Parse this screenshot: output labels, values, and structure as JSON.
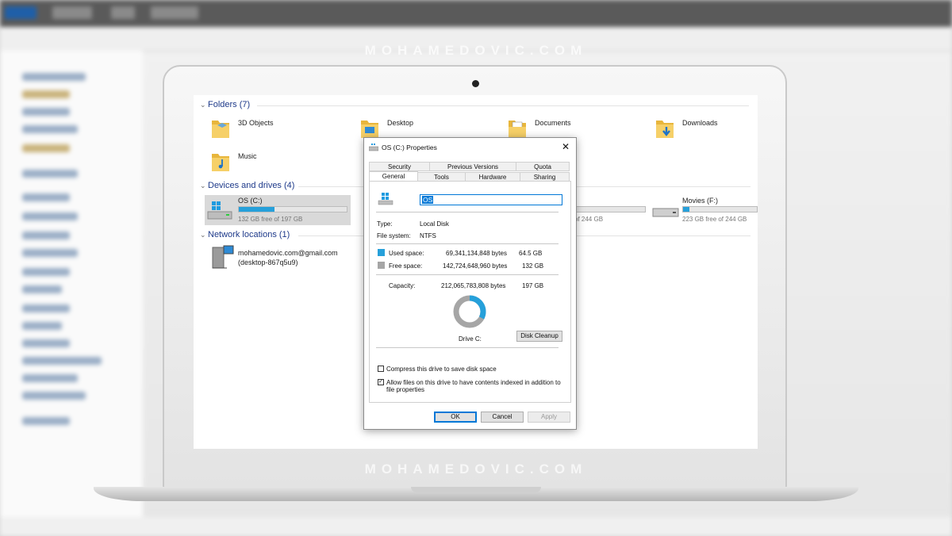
{
  "brand": {
    "top": "MOHAMEDOVIC.COM",
    "bottom": "MOHAMEDOVIC.COM"
  },
  "explorer": {
    "folders_header": "Folders (7)",
    "folders": [
      {
        "name": "3D Objects"
      },
      {
        "name": "Desktop"
      },
      {
        "name": "Documents"
      },
      {
        "name": "Downloads"
      },
      {
        "name": "Music"
      }
    ],
    "devices_header": "Devices and drives (4)",
    "drives": [
      {
        "name": "OS (C:)",
        "free": "132 GB free of 197 GB",
        "used_fraction": 0.33
      },
      {
        "name": "",
        "free": "free of 244 GB",
        "used_fraction": 0.1
      },
      {
        "name": "Movies (F:)",
        "free": "223 GB free of 244 GB",
        "used_fraction": 0.09
      }
    ],
    "network_header": "Network locations (1)",
    "network": {
      "line1": "mohamedovic.com@gmail.com",
      "line2": "(desktop-867q5u9)"
    }
  },
  "dialog": {
    "title": "OS (C:) Properties",
    "tabs_top": [
      "Security",
      "Previous Versions",
      "Quota"
    ],
    "tabs_bottom": [
      "General",
      "Tools",
      "Hardware",
      "Sharing"
    ],
    "name_value": "OS",
    "type_label": "Type:",
    "type_value": "Local Disk",
    "fs_label": "File system:",
    "fs_value": "NTFS",
    "used_label": "Used space:",
    "used_bytes": "69,341,134,848 bytes",
    "used_gb": "64.5 GB",
    "free_label": "Free space:",
    "free_bytes": "142,724,648,960 bytes",
    "free_gb": "132 GB",
    "capacity_label": "Capacity:",
    "capacity_bytes": "212,065,783,808 bytes",
    "capacity_gb": "197 GB",
    "drive_label": "Drive C:",
    "cleanup_label": "Disk Cleanup",
    "compress_label": "Compress this drive to save disk space",
    "index_label_1": "Allow files on this drive to have contents indexed in addition to",
    "index_label_2": "file properties",
    "ok_label": "OK",
    "cancel_label": "Cancel",
    "apply_label": "Apply",
    "used_fraction": 0.327,
    "colors": {
      "used": "#26a0da",
      "free": "#a6a6a6",
      "accent": "#0078d7"
    }
  }
}
